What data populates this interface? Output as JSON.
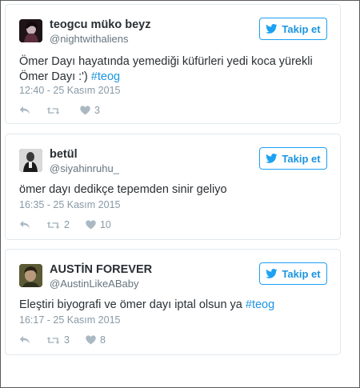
{
  "follow_label": "Takip et",
  "tweets": [
    {
      "name": "teogcu müko beyz",
      "handle": "@nightwithaliens",
      "text_before": "Ömer Dayı hayatında yemediği küfürleri yedi koca yürekli Ömer Dayı :') ",
      "hashtag": "#teog",
      "text_after": "",
      "time": "12:40 - 25 Kasım 2015",
      "retweets": "",
      "likes": "3",
      "avatar_color": "#3a2430"
    },
    {
      "name": "betül",
      "handle": "@siyahinruhu_",
      "text_before": "ömer dayı dedikçe tepemden sinir geliyo",
      "hashtag": "",
      "text_after": "",
      "time": "16:35 - 25 Kasım 2015",
      "retweets": "2",
      "likes": "10",
      "avatar_color": "#2b2b2b"
    },
    {
      "name": "AUSTİN FOREVER",
      "handle": "@AustinLikeABaby",
      "text_before": "Eleştiri biyografi ve ömer dayı iptal olsun ya ",
      "hashtag": "#teog",
      "text_after": "",
      "time": "16:17 - 25 Kasım 2015",
      "retweets": "3",
      "likes": "8",
      "avatar_color": "#4a4a2a"
    }
  ],
  "colors": {
    "accent": "#1da1f2",
    "link": "#1b95e0",
    "meta": "#8899a6",
    "icon": "#aab8c2",
    "border": "#e1e8ed"
  }
}
